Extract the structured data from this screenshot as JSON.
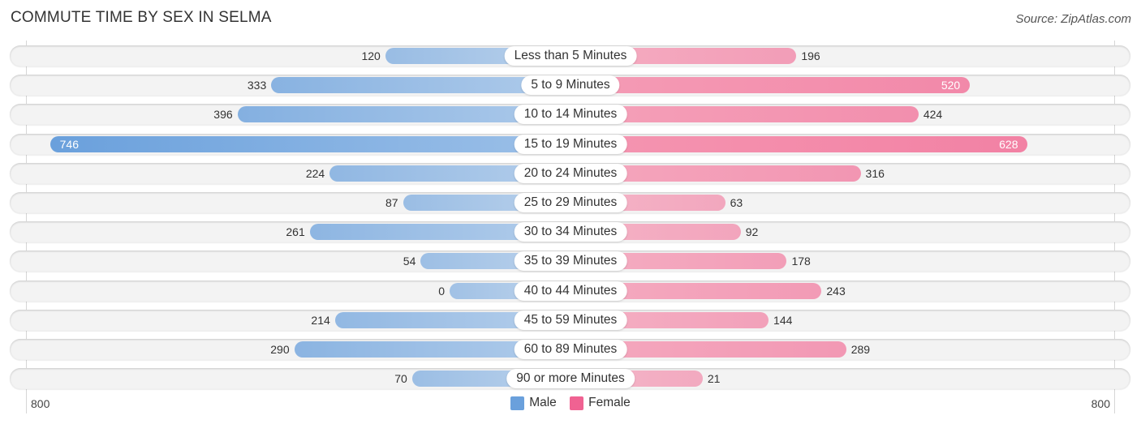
{
  "title": "COMMUTE TIME BY SEX IN SELMA",
  "source": "Source: ZipAtlas.com",
  "colors": {
    "male": "#6aa0dc",
    "female": "#f27a9f"
  },
  "chart_data": {
    "type": "bar",
    "orientation": "horizontal-diverging",
    "title": "COMMUTE TIME BY SEX IN SELMA",
    "categories": [
      "Less than 5 Minutes",
      "5 to 9 Minutes",
      "10 to 14 Minutes",
      "15 to 19 Minutes",
      "20 to 24 Minutes",
      "25 to 29 Minutes",
      "30 to 34 Minutes",
      "35 to 39 Minutes",
      "40 to 44 Minutes",
      "45 to 59 Minutes",
      "60 to 89 Minutes",
      "90 or more Minutes"
    ],
    "series": [
      {
        "name": "Male",
        "values": [
          120,
          333,
          396,
          746,
          224,
          87,
          261,
          54,
          0,
          214,
          290,
          70
        ]
      },
      {
        "name": "Female",
        "values": [
          196,
          520,
          424,
          628,
          316,
          63,
          92,
          178,
          243,
          144,
          289,
          21
        ]
      }
    ],
    "axis": {
      "left_label": "800",
      "right_label": "800",
      "range": [
        0,
        800
      ]
    },
    "legend": {
      "position": "bottom-center",
      "entries": [
        "Male",
        "Female"
      ]
    }
  }
}
